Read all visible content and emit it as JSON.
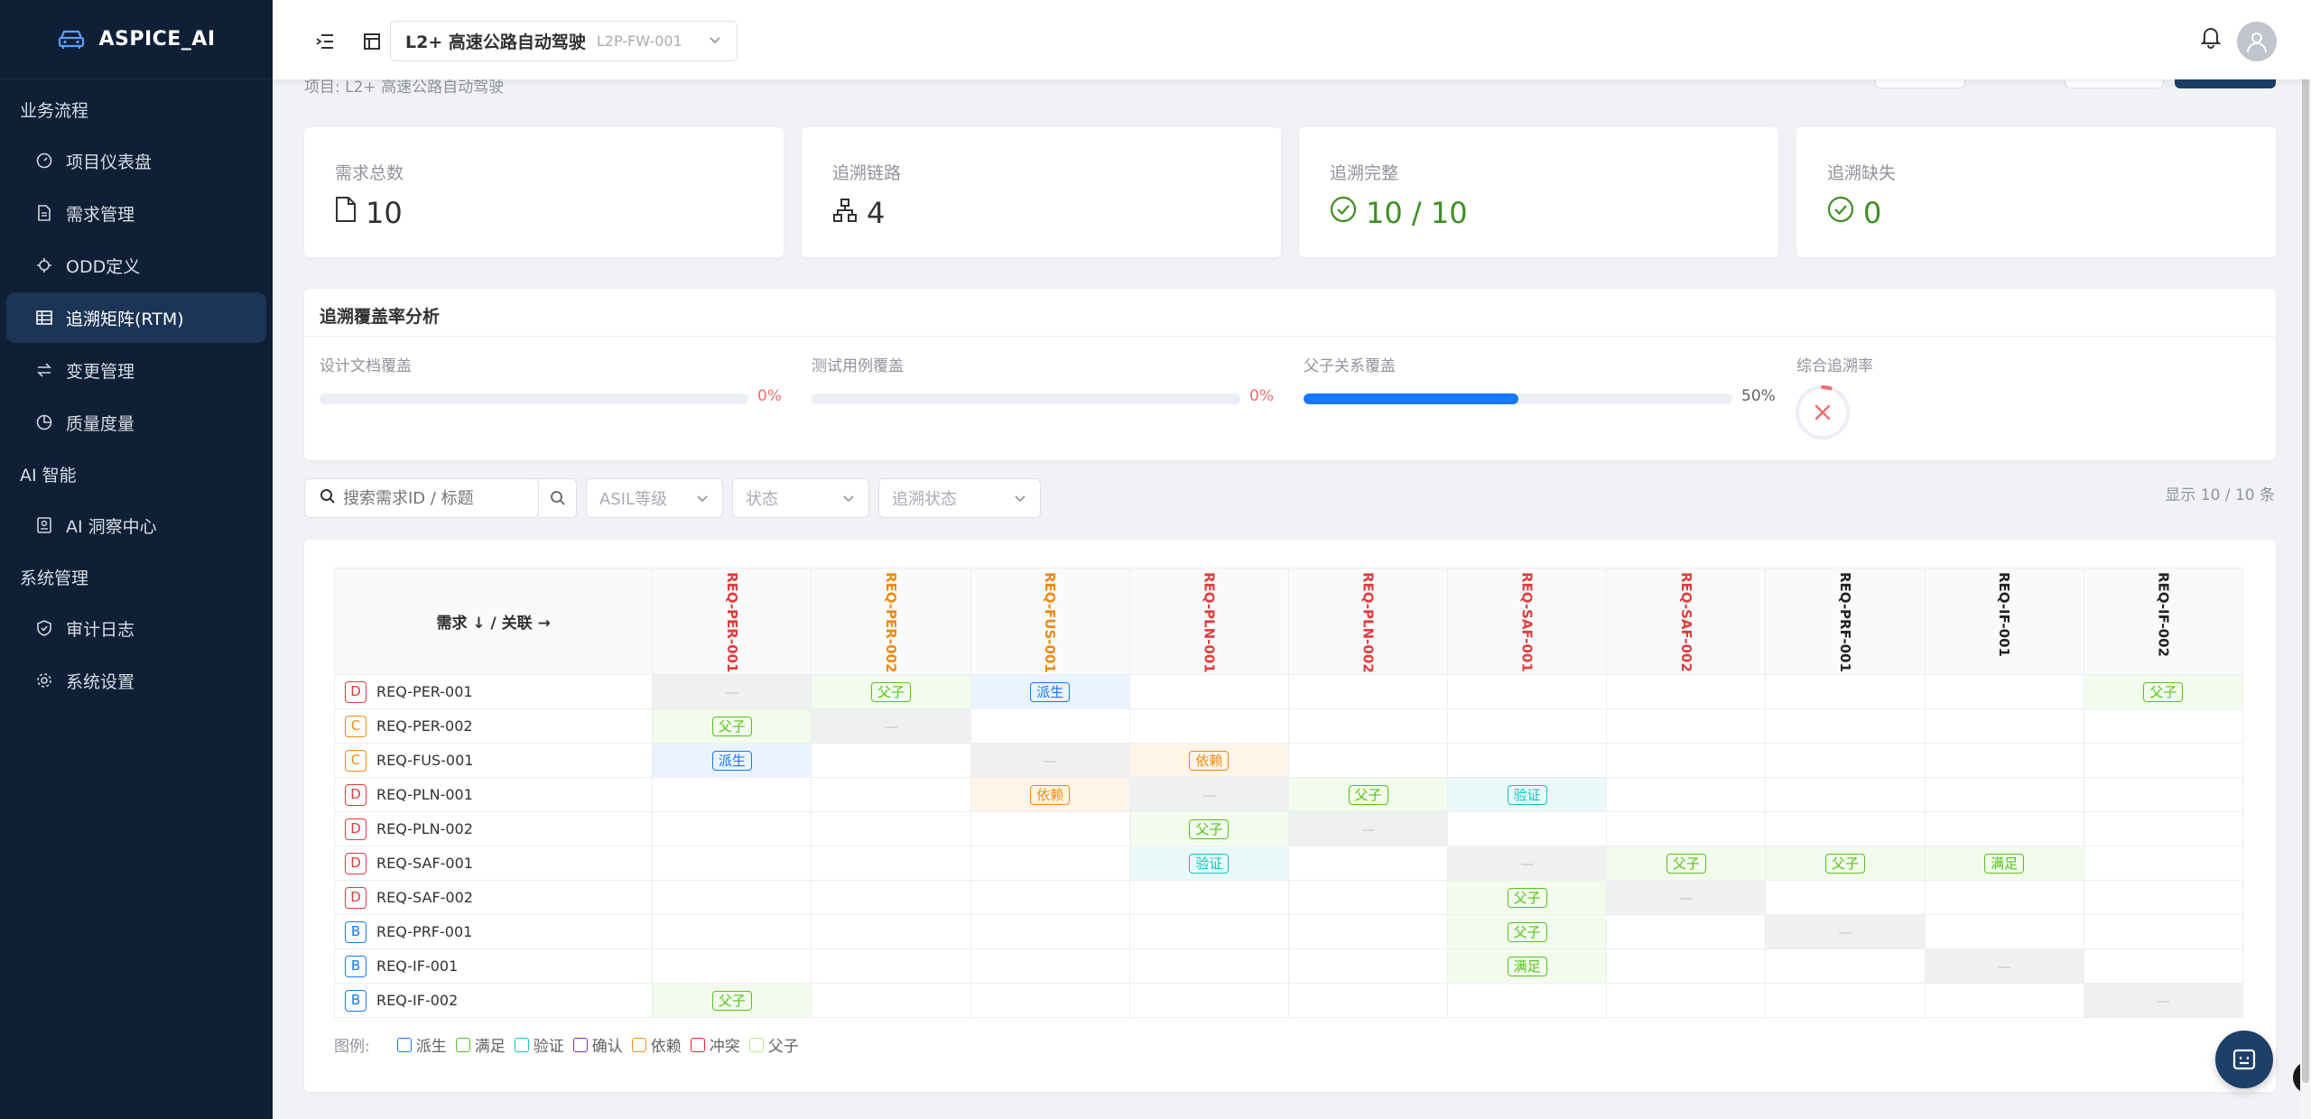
{
  "app": {
    "name": "ASPICE_AI"
  },
  "sidebar": {
    "groups": [
      {
        "label": "业务流程",
        "items": [
          {
            "label": "项目仪表盘",
            "icon": "gauge-icon",
            "active": false
          },
          {
            "label": "需求管理",
            "icon": "document-icon",
            "active": false
          },
          {
            "label": "ODD定义",
            "icon": "target-icon",
            "active": false
          },
          {
            "label": "追溯矩阵(RTM)",
            "icon": "grid-icon",
            "active": true
          },
          {
            "label": "变更管理",
            "icon": "swap-icon",
            "active": false
          },
          {
            "label": "质量度量",
            "icon": "pie-chart-icon",
            "active": false
          }
        ]
      },
      {
        "label": "AI 智能",
        "items": [
          {
            "label": "AI 洞察中心",
            "icon": "badge-icon",
            "active": false
          }
        ]
      },
      {
        "label": "系统管理",
        "items": [
          {
            "label": "审计日志",
            "icon": "shield-check-icon",
            "active": false
          },
          {
            "label": "系统设置",
            "icon": "gear-icon",
            "active": false
          }
        ]
      }
    ]
  },
  "topbar": {
    "project_name": "L2+ 高速公路自动驾驶",
    "project_code": "L2P-FW-001"
  },
  "page": {
    "subtitle": "项目: L2+ 高速公路自动驾驶"
  },
  "stats": [
    {
      "label": "需求总数",
      "value": "10",
      "icon": "file-icon"
    },
    {
      "label": "追溯链路",
      "value": "4",
      "icon": "sitemap-icon"
    },
    {
      "label": "追溯完整",
      "value": "10 / 10",
      "icon": "check-circle-icon"
    },
    {
      "label": "追溯缺失",
      "value": "0",
      "icon": "check-circle-icon"
    }
  ],
  "coverage": {
    "title": "追溯覆盖率分析",
    "items": [
      {
        "label": "设计文档覆盖",
        "percent": 0,
        "text": "0%"
      },
      {
        "label": "测试用例覆盖",
        "percent": 0,
        "text": "0%"
      },
      {
        "label": "父子关系覆盖",
        "percent": 50,
        "text": "50%"
      }
    ],
    "overall_label": "综合追溯率",
    "overall_percent": 5
  },
  "filters": {
    "search_placeholder": "搜索需求ID / 标题",
    "asil": "ASIL等级",
    "status": "状态",
    "trace_status": "追溯状态",
    "count_text": "显示 10 / 10 条"
  },
  "matrix": {
    "corner": "需求 ↓ / 关联 →",
    "columns": [
      {
        "id": "REQ-PER-001",
        "color": "#e23b3b"
      },
      {
        "id": "REQ-PER-002",
        "color": "#ef8a10"
      },
      {
        "id": "REQ-FUS-001",
        "color": "#ef8a10"
      },
      {
        "id": "REQ-PLN-001",
        "color": "#e23b3b"
      },
      {
        "id": "REQ-PLN-002",
        "color": "#e23b3b"
      },
      {
        "id": "REQ-SAF-001",
        "color": "#e23b3b"
      },
      {
        "id": "REQ-SAF-002",
        "color": "#e23b3b"
      },
      {
        "id": "REQ-PRF-001",
        "color": "#222222"
      },
      {
        "id": "REQ-IF-001",
        "color": "#222222"
      },
      {
        "id": "REQ-IF-002",
        "color": "#222222"
      }
    ],
    "rows": [
      {
        "asil": "D",
        "id": "REQ-PER-001",
        "cells": [
          "—",
          "父子",
          "派生",
          "",
          "",
          "",
          "",
          "",
          "",
          "父子"
        ]
      },
      {
        "asil": "C",
        "id": "REQ-PER-002",
        "cells": [
          "父子",
          "—",
          "",
          "",
          "",
          "",
          "",
          "",
          "",
          ""
        ]
      },
      {
        "asil": "C",
        "id": "REQ-FUS-001",
        "cells": [
          "派生",
          "",
          "—",
          "依赖",
          "",
          "",
          "",
          "",
          "",
          ""
        ]
      },
      {
        "asil": "D",
        "id": "REQ-PLN-001",
        "cells": [
          "",
          "",
          "依赖",
          "—",
          "父子",
          "验证",
          "",
          "",
          "",
          ""
        ]
      },
      {
        "asil": "D",
        "id": "REQ-PLN-002",
        "cells": [
          "",
          "",
          "",
          "父子",
          "—",
          "",
          "",
          "",
          "",
          ""
        ]
      },
      {
        "asil": "D",
        "id": "REQ-SAF-001",
        "cells": [
          "",
          "",
          "",
          "验证",
          "",
          "—",
          "父子",
          "父子",
          "满足",
          ""
        ]
      },
      {
        "asil": "D",
        "id": "REQ-SAF-002",
        "cells": [
          "",
          "",
          "",
          "",
          "",
          "父子",
          "—",
          "",
          "",
          ""
        ]
      },
      {
        "asil": "B",
        "id": "REQ-PRF-001",
        "cells": [
          "",
          "",
          "",
          "",
          "",
          "父子",
          "",
          "—",
          "",
          ""
        ]
      },
      {
        "asil": "B",
        "id": "REQ-IF-001",
        "cells": [
          "",
          "",
          "",
          "",
          "",
          "满足",
          "",
          "",
          "—",
          ""
        ]
      },
      {
        "asil": "B",
        "id": "REQ-IF-002",
        "cells": [
          "父子",
          "",
          "",
          "",
          "",
          "",
          "",
          "",
          "",
          "—"
        ]
      }
    ],
    "asil_colors": {
      "D": "#e23b3b",
      "C": "#ef8a10",
      "B": "#1677ff"
    },
    "relation_styles": {
      "派生": {
        "cls": "rel-derive",
        "color": "#1677ff"
      },
      "父子": {
        "cls": "rel-parent",
        "color": "#52c41a"
      },
      "依赖": {
        "cls": "rel-depend",
        "color": "#ef8a10"
      },
      "验证": {
        "cls": "rel-verify",
        "color": "#13c2c2"
      },
      "满足": {
        "cls": "rel-satisfy",
        "color": "#52c41a"
      }
    }
  },
  "legend": {
    "title": "图例:",
    "items": [
      {
        "label": "派生",
        "color": "#1677ff"
      },
      {
        "label": "满足",
        "color": "#52c41a"
      },
      {
        "label": "验证",
        "color": "#13c2c2"
      },
      {
        "label": "确认",
        "color": "#722ed1"
      },
      {
        "label": "依赖",
        "color": "#fa8c16"
      },
      {
        "label": "冲突",
        "color": "#f5222d"
      },
      {
        "label": "父子",
        "color": "#b7eb8f"
      }
    ]
  }
}
